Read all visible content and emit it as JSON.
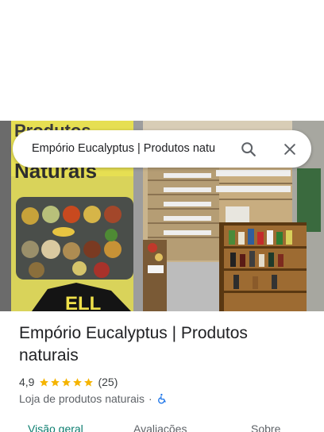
{
  "search": {
    "query": "Empório Eucalyptus | Produtos natu",
    "search_icon": "search-icon",
    "close_icon": "close-icon"
  },
  "place": {
    "name": "Empório Eucalyptus | Produtos naturais",
    "rating": "4,9",
    "stars_filled": 5,
    "reviews": "(25)",
    "category": "Loja de produtos naturais",
    "separator": "·",
    "accessibility_icon": "wheelchair-icon"
  },
  "tabs": [
    {
      "label": "Visão geral",
      "active": true
    },
    {
      "label": "Avaliações",
      "active": false
    },
    {
      "label": "Sobre",
      "active": false
    }
  ],
  "colors": {
    "star": "#f5b400",
    "active_tab": "#0b7d6f",
    "accessibility": "#1a73e8"
  }
}
